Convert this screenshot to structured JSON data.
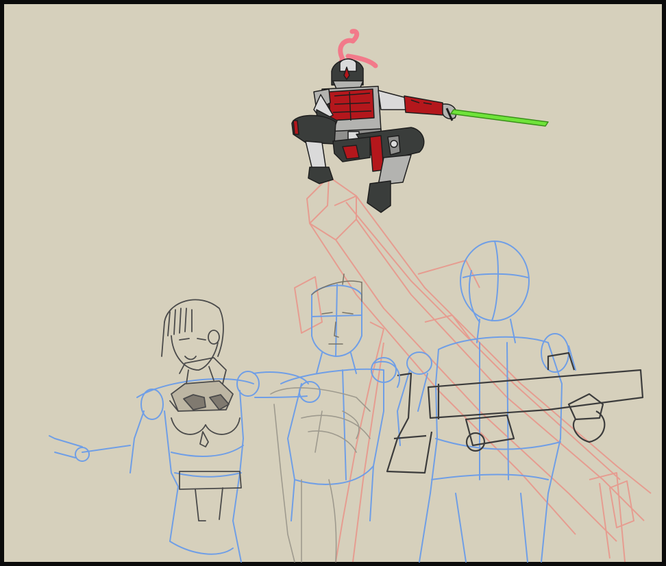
{
  "panel": {
    "background": "#d6d0bc",
    "border_color": "#0b0b0b"
  },
  "palette": {
    "blue_sketch": "#6f9ee6",
    "red_sketch": "#e79a8e",
    "graphite": "#4a4a4a",
    "light_graphite": "#9e9a8e",
    "armor_dark": "#3a3d3b",
    "armor_red": "#b4171c",
    "armor_grey": "#b3b3b0",
    "blade_green": "#6fe33a",
    "plume_pink": "#f27a8a"
  },
  "figures": [
    {
      "id": "armored-ninja",
      "description_icon": "ninja-figure"
    },
    {
      "id": "woman-sketch"
    },
    {
      "id": "man-sketch"
    },
    {
      "id": "back-view-sketch"
    },
    {
      "id": "torii-beam-sketch"
    }
  ]
}
